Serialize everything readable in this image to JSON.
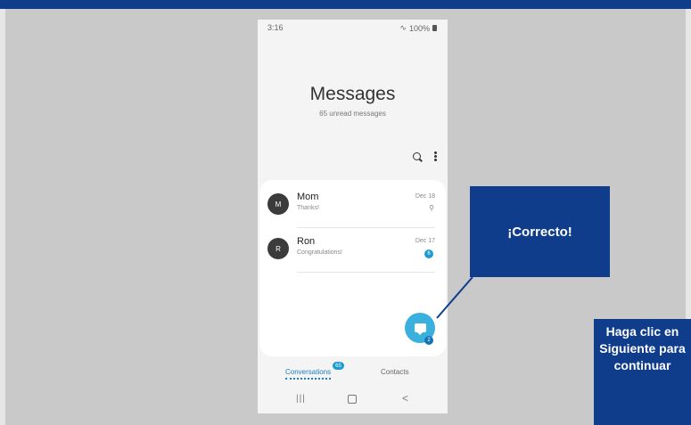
{
  "colors": {
    "accent": "#0f3d8c",
    "fab": "#3ab0dc",
    "badge": "#1d9bd1"
  },
  "phone": {
    "status": {
      "time": "3:16",
      "battery": "100%"
    },
    "title": "Messages",
    "subtitle": "65 unread messages",
    "toolbar": {
      "search_icon": "search-icon",
      "more_icon": "more-vert-icon"
    },
    "conversations": [
      {
        "avatar": "M",
        "name": "Mom",
        "preview": "Thanks!",
        "date": "Dec 18",
        "indicator": "pin"
      },
      {
        "avatar": "R",
        "name": "Ron",
        "preview": "Congratulations!",
        "date": "Dec 17",
        "unread": "6"
      }
    ],
    "fab": {
      "icon": "chat-bubble-icon",
      "badge": "2"
    },
    "tabs": {
      "conversations": "Conversations",
      "conversations_badge": "65",
      "contacts": "Contacts"
    },
    "navbar": {
      "recent": "|||",
      "back": "<"
    }
  },
  "callout": {
    "text": "¡Correcto!"
  },
  "next_hint": {
    "text": "Haga clic en Siguiente para continuar"
  }
}
